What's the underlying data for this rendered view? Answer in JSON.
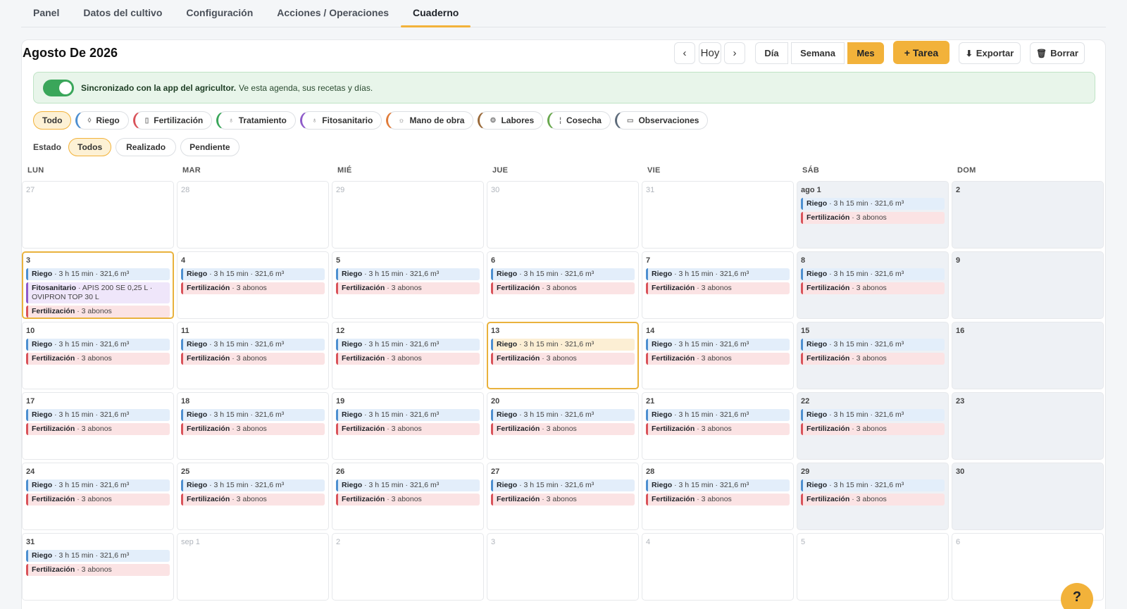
{
  "tabs": [
    "Panel",
    "Datos del cultivo",
    "Configuración",
    "Acciones / Operaciones",
    "Cuaderno"
  ],
  "active_tab": "Cuaderno",
  "header": {
    "title": "Agosto De 2026",
    "prev_label": "‹",
    "today_label": "Hoy",
    "next_label": "›",
    "view_day": "Día",
    "view_week": "Semana",
    "view_month": "Mes",
    "add_task": "+ Tarea",
    "export": "Exportar",
    "delete": "Borrar"
  },
  "sync": {
    "enabled": true,
    "bold_text": "Sincronizado con la app del agricultor.",
    "text": "Ve esta agenda, sus recetas y días."
  },
  "filters": [
    {
      "label": "Todo",
      "icon": "",
      "color": "",
      "active": true
    },
    {
      "label": "Riego",
      "icon": "drop-icon",
      "color": "#4d8fd0"
    },
    {
      "label": "Fertilización",
      "icon": "bottle-icon",
      "color": "#d9535a"
    },
    {
      "label": "Tratamiento",
      "icon": "spray-icon",
      "color": "#3aa65a"
    },
    {
      "label": "Fitosanitario",
      "icon": "flask-icon",
      "color": "#8e5bc9"
    },
    {
      "label": "Mano de obra",
      "icon": "worker-icon",
      "color": "#e07b39"
    },
    {
      "label": "Labores",
      "icon": "tractor-icon",
      "color": "#9a6a3a"
    },
    {
      "label": "Cosecha",
      "icon": "wheat-icon",
      "color": "#6aa84f"
    },
    {
      "label": "Observaciones",
      "icon": "camera-icon",
      "color": "#5d6b7a"
    }
  ],
  "estado": {
    "label": "Estado",
    "options": [
      {
        "label": "Todos",
        "active": true
      },
      {
        "label": "Realizado"
      },
      {
        "label": "Pendiente"
      }
    ]
  },
  "weekdays": [
    "LUN",
    "MAR",
    "MIÉ",
    "JUE",
    "VIE",
    "SÁB",
    "DOM"
  ],
  "events": {
    "riego": {
      "type": "Riego",
      "detail": "· 3 h 15 min · 321,6 m³"
    },
    "fert": {
      "type": "Fertilización",
      "detail": "· 3 abonos"
    },
    "fito": {
      "type": "Fitosanitario",
      "detail": "· APIS 200 SE 0,25 L · OVIPRON TOP 30 L"
    }
  },
  "days": [
    {
      "label": "27",
      "out": true,
      "ev": []
    },
    {
      "label": "28",
      "out": true,
      "ev": []
    },
    {
      "label": "29",
      "out": true,
      "ev": []
    },
    {
      "label": "30",
      "out": true,
      "ev": []
    },
    {
      "label": "31",
      "out": true,
      "ev": []
    },
    {
      "label": "ago 1",
      "ev": [
        "riego",
        "fert"
      ]
    },
    {
      "label": "2",
      "ev": []
    },
    {
      "label": "3",
      "today": true,
      "ev": [
        "riego",
        "fito",
        "fert"
      ]
    },
    {
      "label": "4",
      "ev": [
        "riego",
        "fert"
      ]
    },
    {
      "label": "5",
      "ev": [
        "riego",
        "fert"
      ]
    },
    {
      "label": "6",
      "ev": [
        "riego",
        "fert"
      ]
    },
    {
      "label": "7",
      "ev": [
        "riego",
        "fert"
      ]
    },
    {
      "label": "8",
      "ev": [
        "riego",
        "fert"
      ]
    },
    {
      "label": "9",
      "ev": []
    },
    {
      "label": "10",
      "ev": [
        "riego",
        "fert"
      ]
    },
    {
      "label": "11",
      "ev": [
        "riego",
        "fert"
      ]
    },
    {
      "label": "12",
      "ev": [
        "riego",
        "fert"
      ]
    },
    {
      "label": "13",
      "selected": true,
      "ev": [
        "riego",
        "fert"
      ]
    },
    {
      "label": "14",
      "ev": [
        "riego",
        "fert"
      ]
    },
    {
      "label": "15",
      "ev": [
        "riego",
        "fert"
      ]
    },
    {
      "label": "16",
      "ev": []
    },
    {
      "label": "17",
      "ev": [
        "riego",
        "fert"
      ]
    },
    {
      "label": "18",
      "ev": [
        "riego",
        "fert"
      ]
    },
    {
      "label": "19",
      "ev": [
        "riego",
        "fert"
      ]
    },
    {
      "label": "20",
      "ev": [
        "riego",
        "fert"
      ]
    },
    {
      "label": "21",
      "ev": [
        "riego",
        "fert"
      ]
    },
    {
      "label": "22",
      "ev": [
        "riego",
        "fert"
      ]
    },
    {
      "label": "23",
      "ev": []
    },
    {
      "label": "24",
      "ev": [
        "riego",
        "fert"
      ]
    },
    {
      "label": "25",
      "ev": [
        "riego",
        "fert"
      ]
    },
    {
      "label": "26",
      "ev": [
        "riego",
        "fert"
      ]
    },
    {
      "label": "27",
      "ev": [
        "riego",
        "fert"
      ]
    },
    {
      "label": "28",
      "ev": [
        "riego",
        "fert"
      ]
    },
    {
      "label": "29",
      "ev": [
        "riego",
        "fert"
      ]
    },
    {
      "label": "30",
      "ev": []
    },
    {
      "label": "31",
      "ev": [
        "riego",
        "fert"
      ]
    },
    {
      "label": "sep 1",
      "out": true,
      "ev": []
    },
    {
      "label": "2",
      "out": true,
      "ev": []
    },
    {
      "label": "3",
      "out": true,
      "ev": []
    },
    {
      "label": "4",
      "out": true,
      "ev": []
    },
    {
      "label": "5",
      "out": true,
      "ev": []
    },
    {
      "label": "6",
      "out": true,
      "ev": []
    }
  ],
  "fab_label": "?"
}
